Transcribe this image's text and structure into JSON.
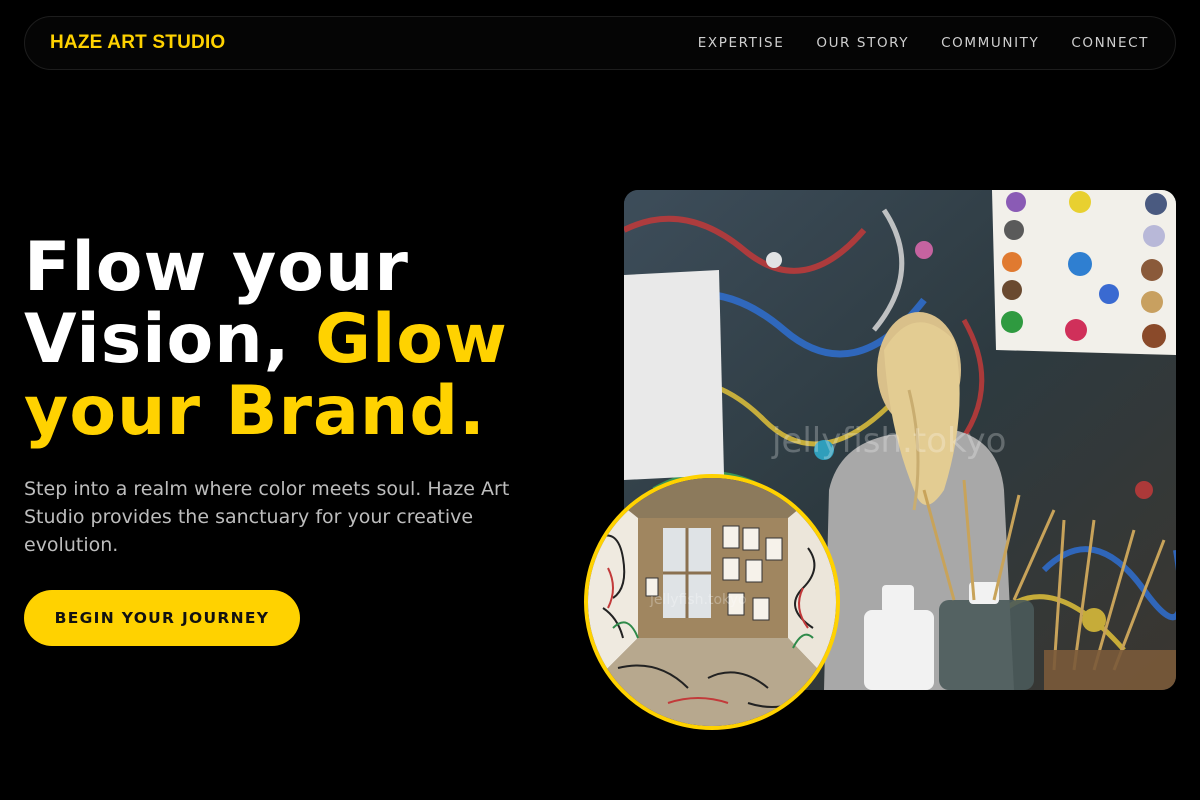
{
  "nav": {
    "brand": "HAZE ART STUDIO",
    "links": [
      {
        "label": "EXPERTISE"
      },
      {
        "label": "OUR STORY"
      },
      {
        "label": "COMMUNITY"
      },
      {
        "label": "CONNECT"
      }
    ]
  },
  "hero": {
    "headline_line1": "Flow your",
    "headline_line2_white": "Vision, ",
    "headline_line2_accent": "Glow",
    "headline_line3_accent": "your Brand.",
    "subtitle": "Step into a realm where color meets soul. Haze Art Studio provides the sanctuary for your creative evolution.",
    "cta_label": "BEGIN YOUR JOURNEY"
  },
  "media": {
    "main_photo_watermark": "jellyfish.tokyo",
    "inset_photo_watermark": "jellyfish.tokyo"
  },
  "colors": {
    "accent": "#ffd200",
    "background": "#000000",
    "text": "#ffffff",
    "muted_text": "#bdbdbd"
  }
}
